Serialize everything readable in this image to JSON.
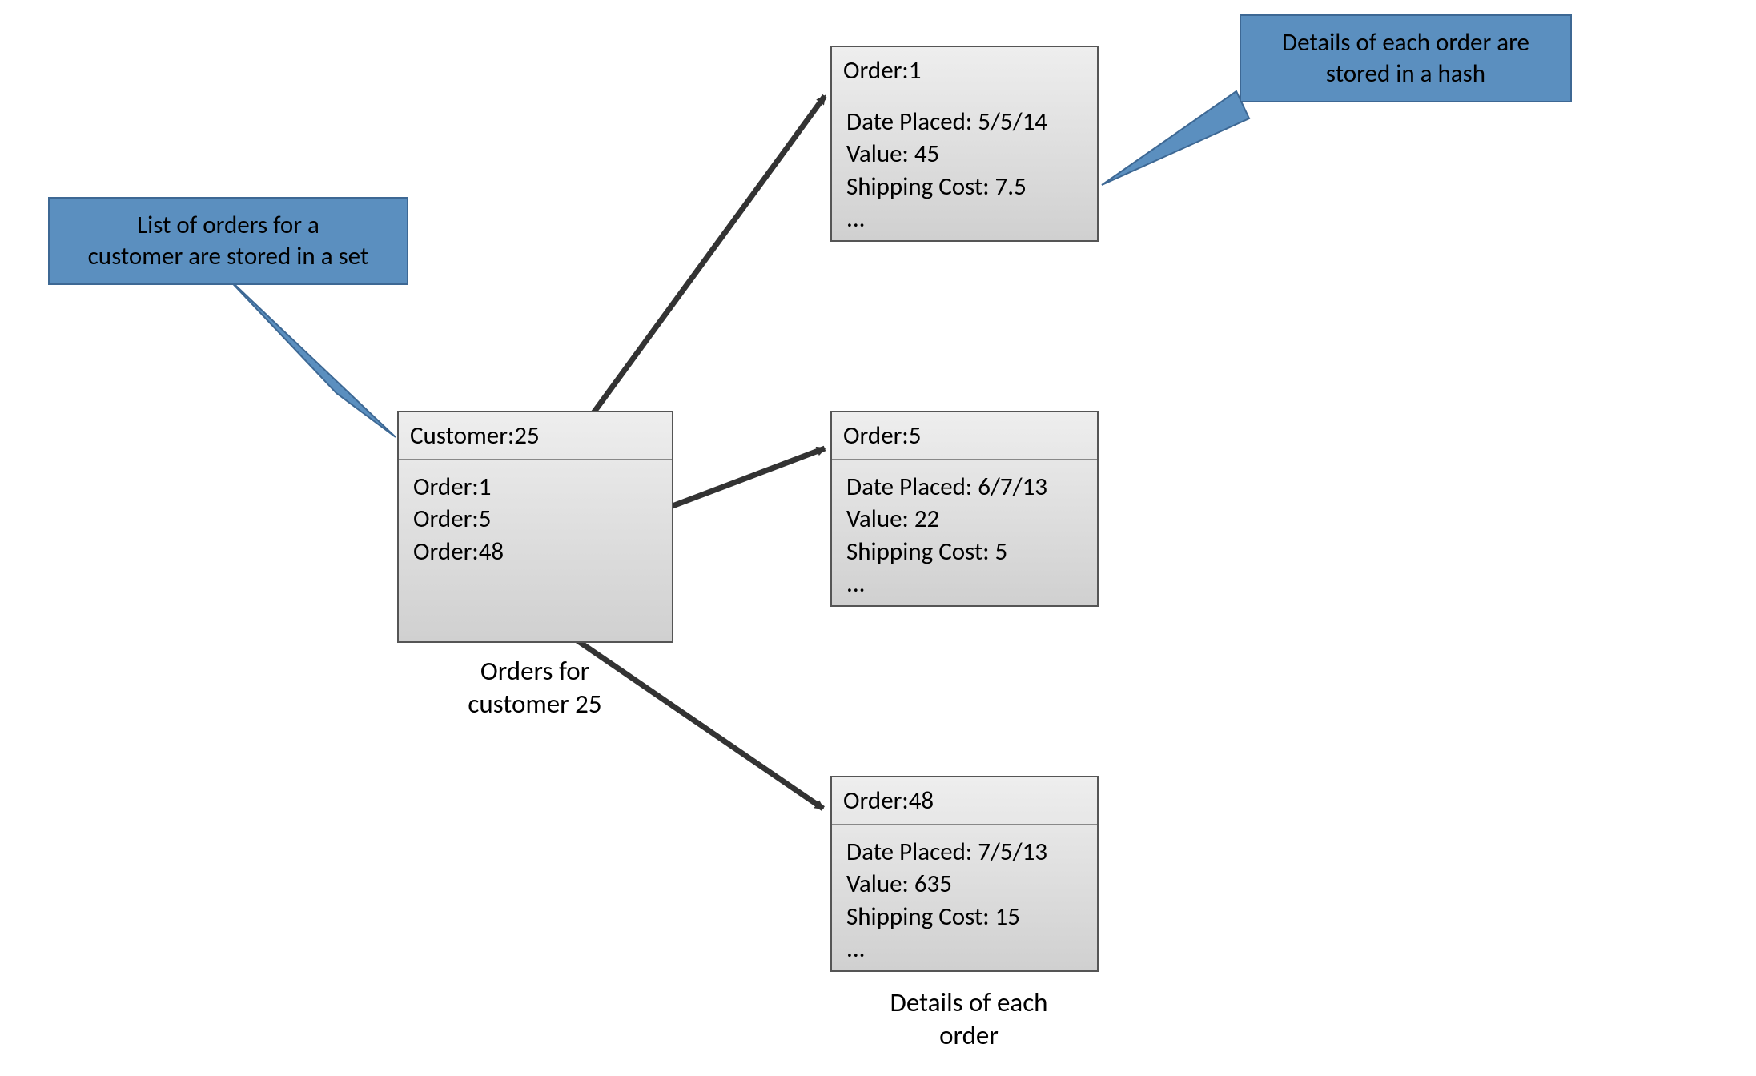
{
  "callouts": {
    "set": {
      "line1": "List of orders for a",
      "line2": "customer are stored in a set"
    },
    "hash": {
      "line1": "Details of each order are",
      "line2": "stored in a hash"
    }
  },
  "customer": {
    "header": "Customer:25",
    "items": [
      "Order:1",
      "Order:5",
      "Order:48"
    ],
    "caption_line1": "Orders for",
    "caption_line2": "customer 25"
  },
  "orders": [
    {
      "header": "Order:1",
      "rows": [
        "Date Placed: 5/5/14",
        "Value: 45",
        "Shipping Cost: 7.5",
        "..."
      ]
    },
    {
      "header": "Order:5",
      "rows": [
        "Date Placed: 6/7/13",
        "Value: 22",
        "Shipping Cost: 5",
        "..."
      ]
    },
    {
      "header": "Order:48",
      "rows": [
        "Date Placed: 7/5/13",
        "Value: 635",
        "Shipping Cost: 15",
        "..."
      ]
    }
  ],
  "orders_caption": {
    "line1": "Details of each",
    "line2": "order"
  }
}
